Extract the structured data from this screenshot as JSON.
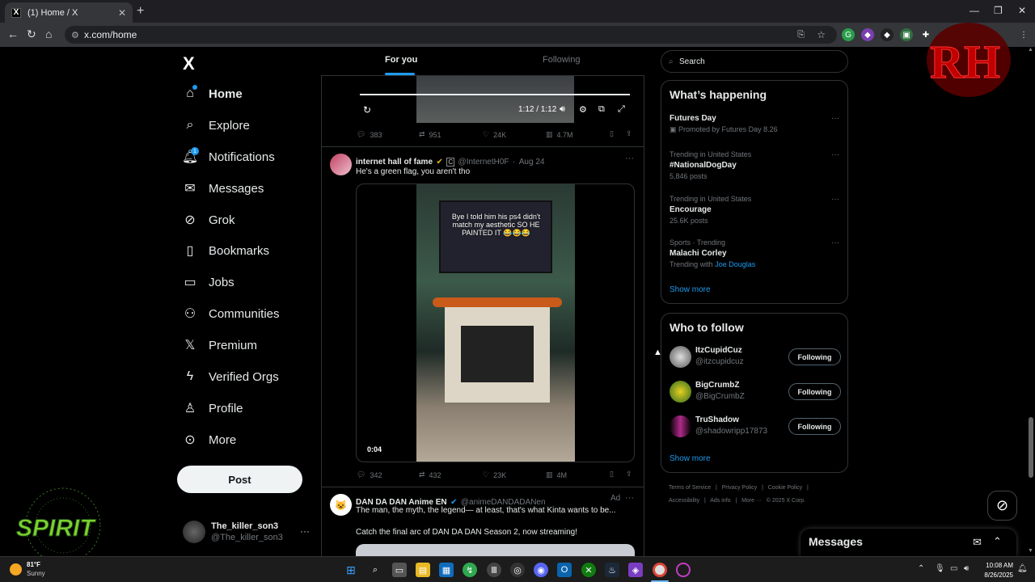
{
  "browser": {
    "tab_title": "(1) Home / X",
    "tab_favicon": "X",
    "new_tab": "+",
    "url": "x.com/home",
    "window_controls": {
      "min": "—",
      "max": "❐",
      "close": "✕"
    }
  },
  "nav": {
    "logo": "X",
    "items": [
      {
        "label": "Home",
        "icon": "home-icon"
      },
      {
        "label": "Explore",
        "icon": "search-icon"
      },
      {
        "label": "Notifications",
        "icon": "bell-icon",
        "badge": "1"
      },
      {
        "label": "Messages",
        "icon": "envelope-icon"
      },
      {
        "label": "Grok",
        "icon": "grok-icon"
      },
      {
        "label": "Bookmarks",
        "icon": "bookmark-icon"
      },
      {
        "label": "Jobs",
        "icon": "briefcase-icon"
      },
      {
        "label": "Communities",
        "icon": "people-icon"
      },
      {
        "label": "Premium",
        "icon": "x-icon"
      },
      {
        "label": "Verified Orgs",
        "icon": "lightning-icon"
      },
      {
        "label": "Profile",
        "icon": "person-icon"
      },
      {
        "label": "More",
        "icon": "more-circle-icon"
      }
    ],
    "post_label": "Post",
    "account": {
      "name": "The_killer_son3",
      "handle": "@The_killer_son3"
    }
  },
  "feed": {
    "tabs": [
      "For you",
      "Following"
    ],
    "video1": {
      "time": "1:12 / 1:12"
    },
    "tweet1_stats": {
      "replies": "383",
      "reposts": "951",
      "likes": "24K",
      "views": "4.7M"
    },
    "tweet2": {
      "name": "internet hall of fame",
      "handle": "@InternetH0F",
      "date": "Aug 24",
      "sep": "·",
      "text": "He's a green flag, you aren't tho",
      "video_caption": "Bye I told him his ps4 didn't match my aesthetic SO HE PAINTED IT 😂😂😂",
      "video_time": "0:04",
      "stats": {
        "replies": "342",
        "reposts": "432",
        "likes": "23K",
        "views": "4M"
      }
    },
    "tweet3": {
      "name": "DAN DA DAN Anime EN",
      "handle": "@animeDANDADANen",
      "ad": "Ad",
      "text1": "The man, the myth, the legend— at least, that's what Kinta wants to be...",
      "text2": "Catch the final arc of DAN DA DAN Season 2, now streaming!"
    }
  },
  "right": {
    "search_placeholder": "Search",
    "happening_title": "What’s happening",
    "trends": [
      {
        "context": "",
        "title": "Futures Day",
        "count": "Promoted by Futures Day 8.26"
      },
      {
        "context": "Trending in United States",
        "title": "#NationalDogDay",
        "count": "5,846 posts"
      },
      {
        "context": "Trending in United States",
        "title": "Encourage",
        "count": "25.6K posts"
      },
      {
        "context": "Sports · Trending",
        "title": "Malachi Corley",
        "count": "Trending with",
        "link": "Joe Douglas"
      }
    ],
    "show_more": "Show more",
    "wtf_title": "Who to follow",
    "follow": [
      {
        "name": "ItzCupidCuz",
        "handle": "@itzcupidcuz",
        "button": "Following"
      },
      {
        "name": "BigCrumbZ",
        "handle": "@BigCrumbZ",
        "button": "Following"
      },
      {
        "name": "TruShadow",
        "handle": "@shadowripp17873",
        "button": "Following"
      }
    ],
    "footer_line1": [
      "Terms of Service",
      "|",
      "Privacy Policy",
      "|",
      "Cookie Policy",
      "|"
    ],
    "footer_line2": [
      "Accessibility",
      "|",
      "Ads info",
      "|",
      "More ···",
      "© 2025 X Corp."
    ],
    "messages_title": "Messages"
  },
  "taskbar": {
    "temp": "81°F",
    "condition": "Sunny",
    "time": "10:08 AM",
    "date": "8/26/2025"
  },
  "colors": {
    "accent": "#1d9bf0",
    "bg": "#000000",
    "border": "#2f3336",
    "muted": "#71767b"
  }
}
